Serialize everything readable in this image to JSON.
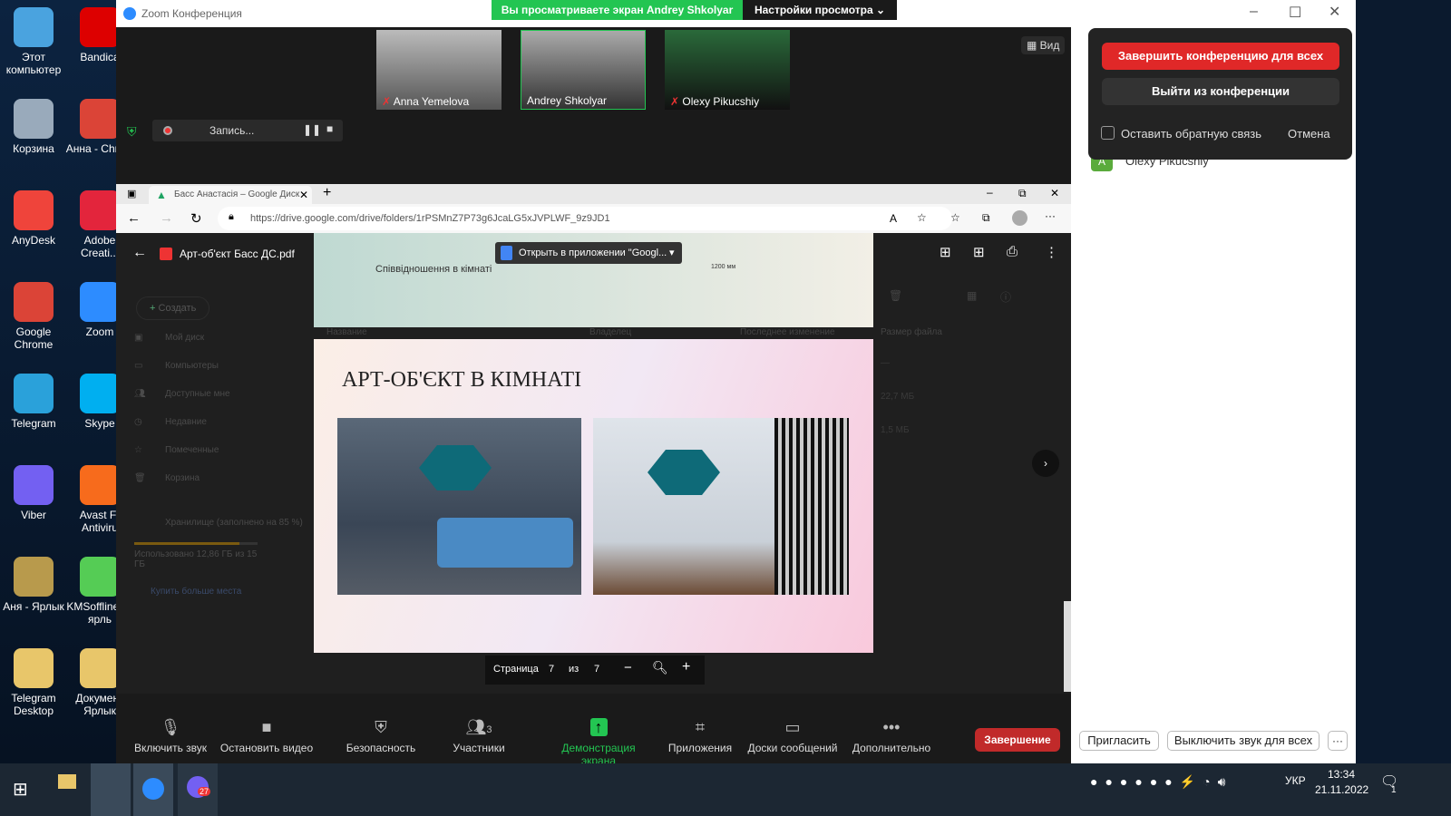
{
  "desktop": {
    "icons": [
      {
        "label": "Этот компьютер",
        "color": "#4aa3df"
      },
      {
        "label": "Bandica",
        "color": "#d00"
      },
      {
        "label": "Корзина",
        "color": "#9ab"
      },
      {
        "label": "Анна - Chrom",
        "color": "#db4437"
      },
      {
        "label": "AnyDesk",
        "color": "#ef443b"
      },
      {
        "label": "Adobe Creati...",
        "color": "#e3253c"
      },
      {
        "label": "Google Chrome",
        "color": "#db4437"
      },
      {
        "label": "Zoom",
        "color": "#2d8cff"
      },
      {
        "label": "Telegram",
        "color": "#2aa1da"
      },
      {
        "label": "Skype",
        "color": "#00aff0"
      },
      {
        "label": "Viber",
        "color": "#7360f2"
      },
      {
        "label": "Avast Fr Antiviru",
        "color": "#f76b1c"
      },
      {
        "label": "Аня - Ярлык",
        "color": "#b89a4c"
      },
      {
        "label": "KMSoffline — ярль",
        "color": "#5c5"
      },
      {
        "label": "Telegram Desktop",
        "color": "#e8c66a"
      },
      {
        "label": "Документ Ярлык",
        "color": "#e8c66a"
      }
    ]
  },
  "zoom": {
    "window_title": "Zoom Конференция",
    "viewing_banner": "Вы просматриваете экран Andrey Shkolyar",
    "view_settings": "Настройки просмотра",
    "view_button": "Вид",
    "recording": "Запись...",
    "participants": [
      {
        "name": "Anna Yemelova",
        "muted": true
      },
      {
        "name": "Andrey Shkolyar",
        "muted": false,
        "active": true
      },
      {
        "name": "Olexy Pikucshiy",
        "muted": true
      }
    ],
    "toolbar": [
      {
        "label": "Включить звук",
        "icon": "mic-muted-icon"
      },
      {
        "label": "Остановить видео",
        "icon": "video-icon"
      },
      {
        "label": "Безопасность",
        "icon": "shield-icon"
      },
      {
        "label": "Участники",
        "icon": "participants-icon",
        "count": "3"
      },
      {
        "label": "Демонстрация экрана",
        "icon": "share-screen-icon"
      },
      {
        "label": "Приложения",
        "icon": "apps-icon"
      },
      {
        "label": "Доски сообщений",
        "icon": "whiteboard-icon"
      },
      {
        "label": "Дополнительно",
        "icon": "more-icon"
      }
    ],
    "end_button": "Завершение",
    "end_popup": {
      "end_all": "Завершить конференцию для всех",
      "leave": "Выйти из конференции",
      "feedback": "Оставить обратную связь",
      "cancel": "Отмена"
    },
    "panel_participant": "Olexy Pikucshiy",
    "invite": "Пригласить",
    "mute_all": "Выключить звук для всех",
    "more": "···",
    "accent": "#2d8cff",
    "end_red": "#e02828"
  },
  "browser": {
    "tab_title": "Басс Анастасія – Google Диск",
    "url": "https://drive.google.com/drive/folders/1rPSMnZ7P73g6JcaLG5xJVPLWF_9z9JD1",
    "pdf_name": "Арт-об'єкт Басс ДС.pdf",
    "open_with": "Открыть в приложении \"Googl...",
    "prev_page_caption": "Співвідношення в кімнаті",
    "prev_page_dim": "1200 мм",
    "slide_title": "АРТ-ОБ'ЄКТ В КІМНАТІ",
    "page_label": "Страница",
    "page_current": "7",
    "page_of": "из",
    "page_total": "7"
  },
  "drive": {
    "create": "Создать",
    "nav": [
      "Мой диск",
      "Компьютеры",
      "Доступные мне",
      "Недавние",
      "Помеченные",
      "Корзина"
    ],
    "storage": "Хранилище (заполнено на 85 %)",
    "storage_fraction": 0.85,
    "storage_used": "Использовано 12,86 ГБ из 15 ГБ",
    "buy": "Купить больше места",
    "columns": [
      "Название",
      "Владелец",
      "Последнее изменение",
      "Размер файла"
    ],
    "sizes": [
      "—",
      "22,7 МБ",
      "1,5 МБ"
    ]
  },
  "taskbar": {
    "lang": "УКР",
    "time": "13:34",
    "date": "21.11.2022",
    "notif_count": "1",
    "viber_badge": "27"
  }
}
